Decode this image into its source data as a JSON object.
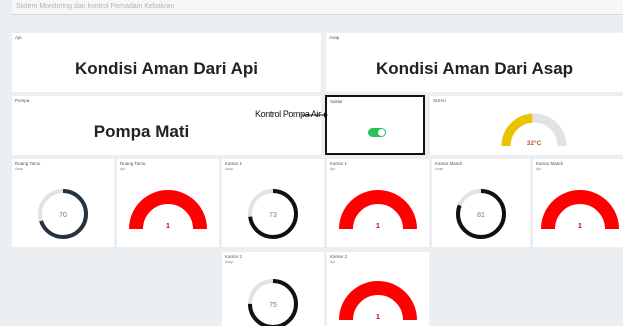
{
  "app": {
    "title": "Sistem Monitoring dan kontrol Pemadam Kebakran"
  },
  "api": {
    "label": "Api",
    "status": "Kondisi Aman Dari Api"
  },
  "asap": {
    "label": "Asap",
    "status": "Kondisi Aman Dari Asap"
  },
  "pompa": {
    "label": "Pompa",
    "status": "Pompa Mati"
  },
  "annotation": {
    "text": "Kontrol Pompa Air"
  },
  "saklar": {
    "label": "Saklar",
    "state": true,
    "color": "#2bc25a"
  },
  "suhu": {
    "label": "SUHU",
    "value": "32°C",
    "fill": 0.48,
    "color": "#e9c400",
    "min": "",
    "max": ""
  },
  "colors": {
    "ring_dark": "#25323f",
    "ring_black": "#111111",
    "arc_red": "#ff0000",
    "frame": "#111111"
  },
  "sensors": [
    {
      "room": "Ruang Tamu",
      "type": "Asap",
      "value": "70"
    },
    {
      "room": "Ruang Tamu",
      "type": "Api",
      "value": "1"
    },
    {
      "room": "Kamar 1",
      "type": "Asap",
      "value": "73"
    },
    {
      "room": "Kamar 1",
      "type": "Api",
      "value": "1"
    },
    {
      "room": "Kamar Mandi",
      "type": "Asap",
      "value": "81"
    },
    {
      "room": "Kamar Mandi",
      "type": "Api",
      "value": "1"
    },
    {
      "room": "Kamar 2",
      "type": "Asap",
      "value": "75"
    },
    {
      "room": "Kamar 2",
      "type": "Api",
      "value": "1"
    }
  ]
}
